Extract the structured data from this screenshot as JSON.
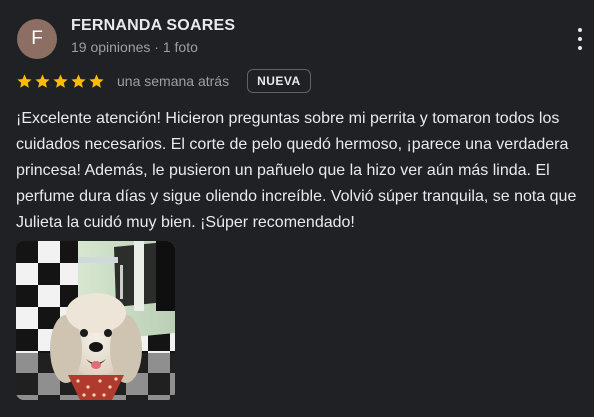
{
  "review": {
    "author": {
      "initial": "F",
      "name": "FERNANDA SOARES",
      "meta": "19 opiniones · 1 foto"
    },
    "rating": 5,
    "star_color": "#fbbc04",
    "time_ago": "una semana atrás",
    "badge": "NUEVA",
    "text": "¡Excelente atención! Hicieron preguntas sobre mi perrita y tomaron todos los cuidados necesarios. El corte de pelo quedó hermoso, ¡parece una verdadera princesa! Además, le pusieron un pañuelo que la hizo ver aún más linda. El perfume dura días y sigue oliendo increíble. Volvió súper tranquila, se nota que Julieta la cuidó muy bien. ¡Súper recomendado!",
    "photo_count": 1
  },
  "icons": {
    "more": "more-vert-icon",
    "star": "star-icon"
  },
  "colors": {
    "background": "#202124",
    "avatar": "#8d6e63",
    "text_primary": "#e8eaed",
    "text_secondary": "#9aa0a6"
  }
}
